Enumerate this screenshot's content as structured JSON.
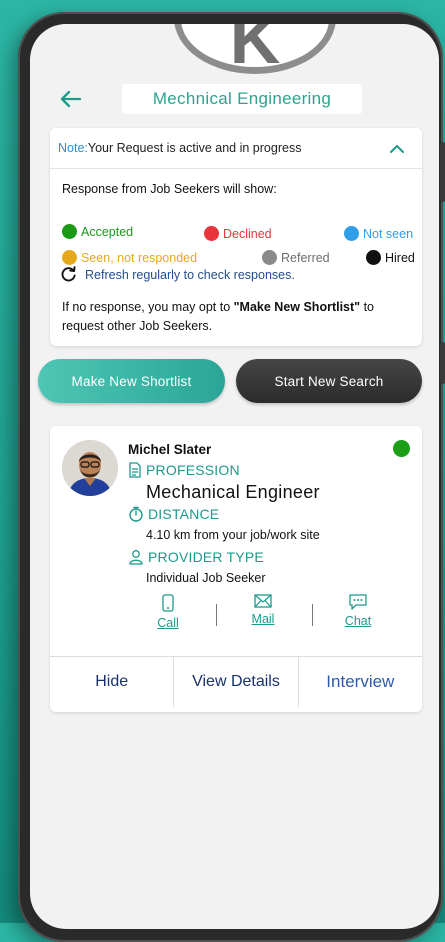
{
  "header": {
    "back_icon": "arrow-left-icon",
    "title": "Mechnical Engineering"
  },
  "note": {
    "label": "Note:",
    "text": "Your Request is active and in progress",
    "toggle_icon": "chevron-up-icon"
  },
  "legend": {
    "title": "Response from Job Seekers will show:",
    "items": [
      {
        "label": "Accepted",
        "color": "#1a9a16"
      },
      {
        "label": "Declined",
        "color": "#e8343a"
      },
      {
        "label": "Not seen",
        "color": "#2e9ee8"
      },
      {
        "label": "Seen, not responded",
        "color": "#e6a91c"
      },
      {
        "label": "Referred",
        "color": "#8a8a8a"
      },
      {
        "label": "Hired",
        "color": "#111111"
      }
    ]
  },
  "refresh_text": "Refresh regularly to check responses.",
  "no_response": {
    "before": "If no response, you may opt to ",
    "highlight": "\"Make New Shortlist\"",
    "after": " to request other Job Seekers."
  },
  "buttons": {
    "make_shortlist": "Make New Shortlist",
    "start_search": "Start New Search"
  },
  "provider": {
    "name": "Michel Slater",
    "status_color": "#1a9f16",
    "profession_label": "PROFESSION",
    "profession": "Mechanical Engineer",
    "distance_label": "DISTANCE",
    "distance": "4.10 km from your job/work site",
    "provider_type_label": "PROVIDER TYPE",
    "provider_type": "Individual Job Seeker",
    "contacts": {
      "call": "Call",
      "mail": "Mail",
      "chat": "Chat"
    },
    "actions": {
      "hide": "Hide",
      "view_details": "View Details",
      "interview": "Interview"
    }
  }
}
